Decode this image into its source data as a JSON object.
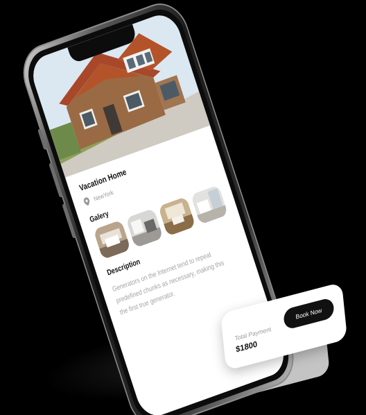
{
  "property": {
    "title": "Vacation Home",
    "location": "NewYork"
  },
  "sections": {
    "gallery_title": "Galery",
    "description_title": "Description",
    "description_text": "Generators on the Internet tend to repeat predefined chunks as necessary, making this the first true generator."
  },
  "payment": {
    "label": "Total Payment",
    "amount": "$1800",
    "book_label": "Book Now"
  },
  "icons": {
    "location": "map-pin-icon"
  },
  "colors": {
    "background": "#000000",
    "card": "#ffffff",
    "primary_button": "#111111",
    "muted_text": "#9a9a9a",
    "roof": "#b4532a",
    "brick": "#9a6a44"
  }
}
